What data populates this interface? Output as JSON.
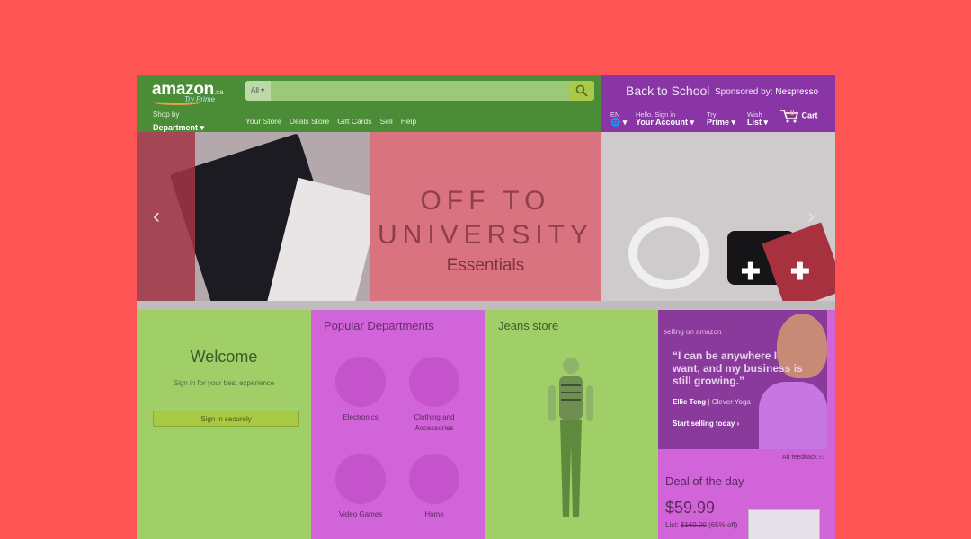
{
  "header": {
    "logo": {
      "word": "amazon",
      "tld": ".ca",
      "tagline": "Try Prime"
    },
    "search": {
      "category": "All ▾",
      "placeholder": ""
    },
    "shop_by": {
      "line1": "Shop by",
      "line2": "Department ▾"
    },
    "nav_links": [
      "Your Store",
      "Deals Store",
      "Gift Cards",
      "Sell",
      "Help"
    ],
    "promo": {
      "text": "Back to School",
      "sponsored_label": "Sponsored by:",
      "sponsor": "Nespresso"
    },
    "language": {
      "line1": "EN",
      "line2": "🌐 ▾"
    },
    "account": {
      "line1": "Hello. Sign in",
      "line2": "Your Account ▾"
    },
    "prime": {
      "line1": "Try",
      "line2": "Prime ▾"
    },
    "wishlist": {
      "line1": "Wish",
      "line2": "List ▾"
    },
    "cart": {
      "label": "Cart",
      "count": "0"
    }
  },
  "hero": {
    "title_line1": "OFF TO",
    "title_line2": "UNIVERSITY",
    "subtitle": "Essentials",
    "prev_icon": "chevron-left-icon",
    "next_icon": "chevron-right-icon"
  },
  "welcome": {
    "title": "Welcome",
    "subtitle": "Sign in for your best experience",
    "button": "Sign in securely"
  },
  "popular": {
    "title": "Popular Departments",
    "items": [
      {
        "label": "Electronics"
      },
      {
        "label": "Clothing and Accessories"
      },
      {
        "label": "Video Games"
      },
      {
        "label": "Home"
      }
    ]
  },
  "jeans": {
    "title": "Jeans store"
  },
  "sell_ad": {
    "brand": "selling on amazon",
    "quote": "“I can be anywhere I want, and my business is still growing.”",
    "person": "Ellie Teng",
    "company": "| Clever Yoga",
    "cta": "Start selling today ›",
    "feedback": "Ad feedback"
  },
  "deal": {
    "title": "Deal of the day",
    "price": "$59.99",
    "list_label": "List:",
    "list_price": "$169.00",
    "savings": "(65% off)"
  },
  "colors": {
    "background": "#ff5454",
    "green_overlay": "#9fcf66",
    "magenta_overlay": "#d164d8",
    "header_green": "#4a8d36",
    "header_purple": "#8a35a5"
  }
}
